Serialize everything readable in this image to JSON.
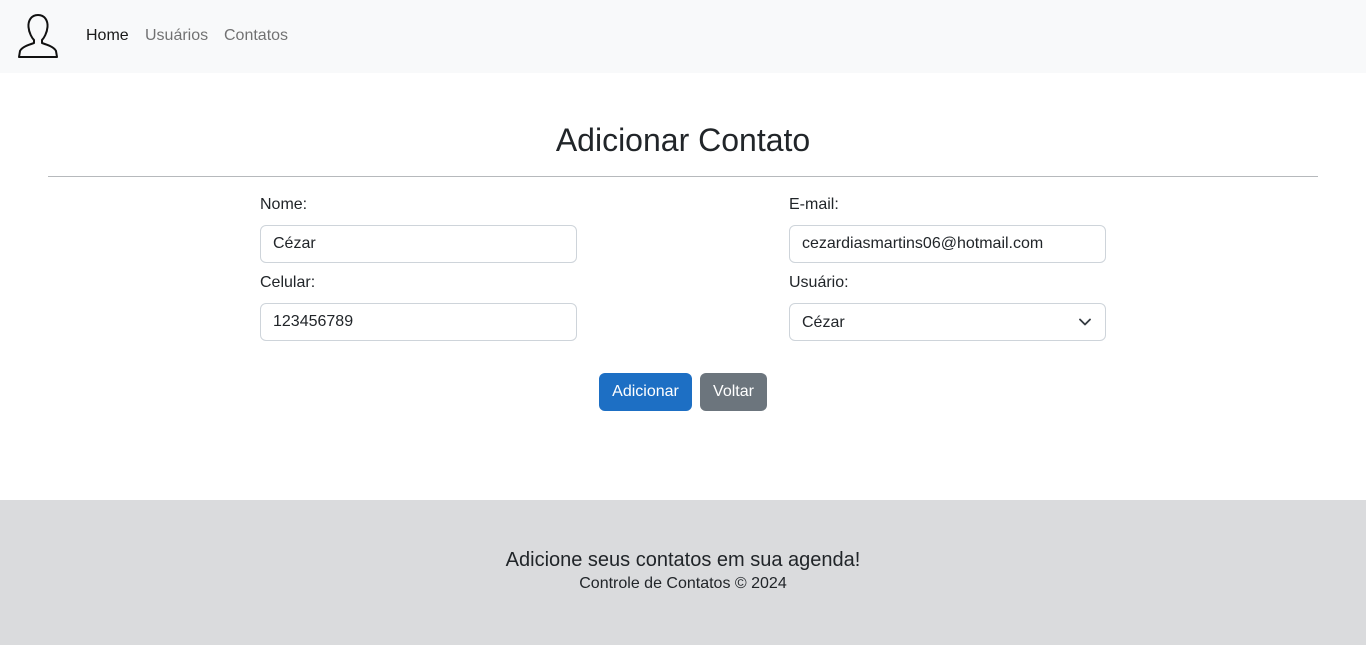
{
  "navbar": {
    "brand_icon": "user-silhouette-icon",
    "links": [
      {
        "label": "Home",
        "active": true
      },
      {
        "label": "Usuários",
        "active": false
      },
      {
        "label": "Contatos",
        "active": false
      }
    ]
  },
  "form": {
    "title": "Adicionar Contato",
    "fields": {
      "nome": {
        "label": "Nome:",
        "value": "Cézar"
      },
      "email": {
        "label": "E-mail:",
        "value": "cezardiasmartins06@hotmail.com"
      },
      "celular": {
        "label": "Celular:",
        "value": "123456789"
      },
      "usuario": {
        "label": "Usuário:",
        "selected": "Cézar"
      }
    },
    "buttons": {
      "submit_label": "Adicionar",
      "back_label": "Voltar"
    }
  },
  "footer": {
    "headline": "Adicione seus contatos em sua agenda!",
    "copyright": "Controle de Contatos © 2024"
  },
  "colors": {
    "navbar_bg": "#f8f9fa",
    "primary": "#1d6fc4",
    "secondary": "#6c757d",
    "footer_bg": "#dadbdd"
  }
}
